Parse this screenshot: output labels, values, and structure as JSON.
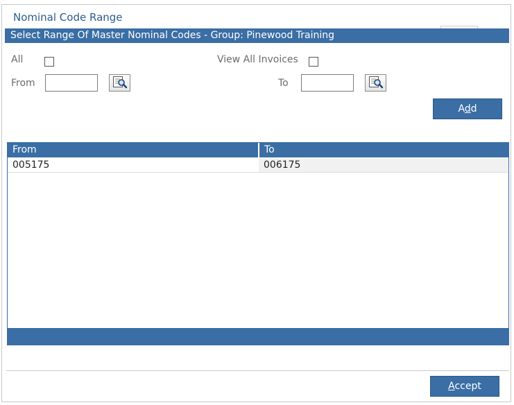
{
  "window": {
    "title": "Nominal Code Range"
  },
  "header": {
    "text": "Select Range Of Master Nominal Codes - Group: Pinewood Training"
  },
  "filters": {
    "all_label": "All",
    "view_all_invoices_label": "View All Invoices",
    "from_label": "From",
    "to_label": "To",
    "from_value": "",
    "to_value": "",
    "lookup_icon": "search-lookup-icon"
  },
  "buttons": {
    "add_prefix": "A",
    "add_accel": "d",
    "add_suffix": "d",
    "accept_accel": "A",
    "accept_suffix": "ccept"
  },
  "grid": {
    "columns": [
      "From",
      "To"
    ],
    "rows": [
      {
        "from": "005175",
        "to": "006175"
      }
    ]
  },
  "colors": {
    "accent": "#3a6ea5",
    "title_text": "#2a5d8c",
    "label_text": "#6b6b6b"
  }
}
